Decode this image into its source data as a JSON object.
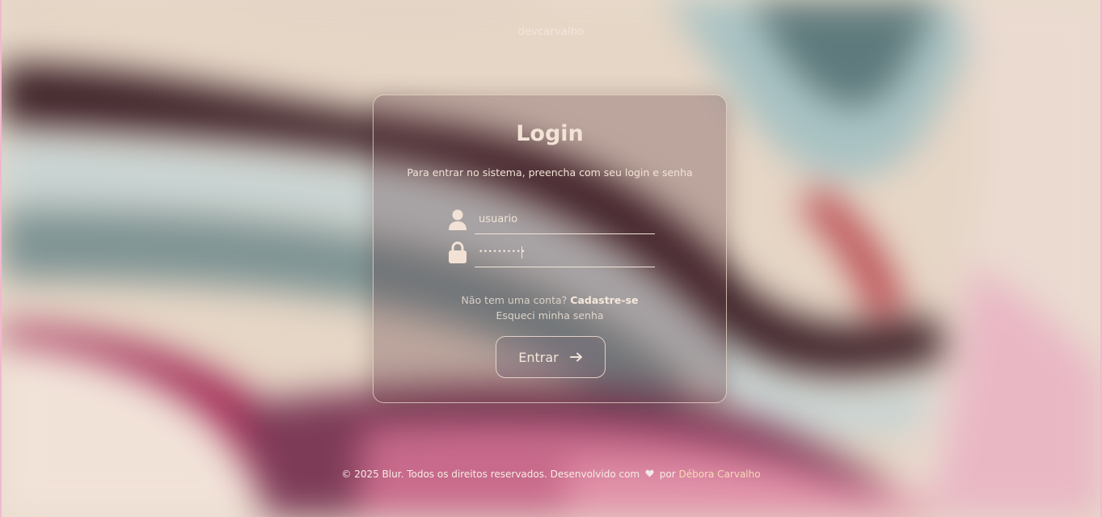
{
  "header": {
    "brand": "devcarvalho"
  },
  "login": {
    "title": "Login",
    "subtitle": "Para entrar no sistema, preencha com seu login e senha",
    "username": {
      "placeholder": "usuario",
      "value": "",
      "icon": "user-icon"
    },
    "password": {
      "placeholder": "",
      "value": "••••••••••",
      "icon": "lock-icon"
    },
    "no_account_text": "Não tem uma conta?",
    "signup_link": "Cadastre-se",
    "forgot_link": "Esqueci minha senha",
    "submit_label": "Entrar",
    "submit_icon": "arrow-right-icon"
  },
  "footer": {
    "copyright": "© 2025 Blur. Todos os direitos reservados. Desenvolvido com",
    "heart_icon": "heart-icon",
    "by": "por",
    "author": "Débora Carvalho"
  },
  "colors": {
    "text": "#f2e3d6",
    "card_border": "#f0dccd",
    "author_link": "#f7d9b8",
    "frame_accent": "#f3b8cf"
  }
}
